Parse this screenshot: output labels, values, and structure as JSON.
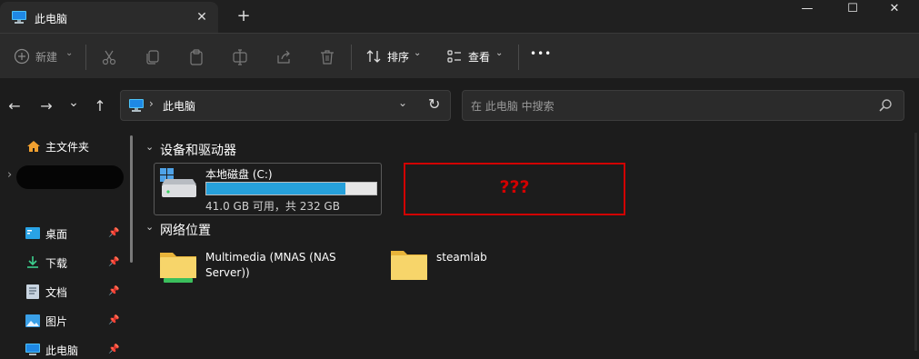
{
  "window": {
    "tab_title": "此电脑",
    "close_tab": "✕",
    "new_tab": "+",
    "minimize": "—",
    "maximize": "☐",
    "close": "✕"
  },
  "toolbar": {
    "new_label": "新建",
    "sort_label": "排序",
    "view_label": "查看",
    "more_label": "•••",
    "icons": [
      "new-icon",
      "cut-icon",
      "copy-icon",
      "paste-icon",
      "rename-icon",
      "share-icon",
      "delete-icon",
      "sort-icon",
      "view-icon",
      "more-icon"
    ]
  },
  "nav": {
    "back": "←",
    "forward": "→",
    "recent": "⌄",
    "up": "↑",
    "address_separator": "›",
    "address_label": "此电脑",
    "refresh": "↻",
    "search_placeholder": "在 此电脑 中搜索"
  },
  "sidebar": {
    "home": "主文件夹",
    "items": [
      {
        "label": "桌面",
        "icon": "desktop-icon"
      },
      {
        "label": "下载",
        "icon": "download-icon"
      },
      {
        "label": "文档",
        "icon": "document-icon"
      },
      {
        "label": "图片",
        "icon": "pictures-icon"
      },
      {
        "label": "此电脑",
        "icon": "computer-icon"
      }
    ]
  },
  "main": {
    "devices_title": "设备和驱动器",
    "drive": {
      "name": "本地磁盘 (C:)",
      "usage_text": "41.0 GB 可用，共 232 GB",
      "used_fraction": 0.82
    },
    "unknown_label": "???",
    "network_title": "网络位置",
    "network_items": [
      {
        "line1": "Multimedia (MNAS (NAS",
        "line2": "Server))"
      },
      {
        "line1": "steamlab",
        "line2": ""
      }
    ]
  },
  "colors": {
    "accent": "#26a0da",
    "highlight": "#d10000",
    "folder": "#f5c842"
  }
}
